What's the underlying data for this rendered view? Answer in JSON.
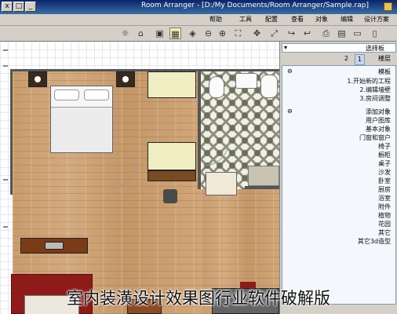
{
  "window": {
    "title": "Room Arranger - [D:/My Documents/Room Arranger/Sample.rap]",
    "buttons": [
      "_",
      "□",
      "x"
    ]
  },
  "menu": [
    "设计方案",
    "编辑",
    "对象",
    "查看",
    "配置",
    "工具",
    "帮助"
  ],
  "toolbar": [
    "new",
    "open",
    "save",
    "print",
    "undo",
    "redo",
    "zoom-in",
    "zoom-out",
    "fit",
    "3d-view",
    "wall",
    "door",
    "window",
    "lamp"
  ],
  "panel": {
    "combo_value": "选择板",
    "tabs": [
      "楼层",
      "1",
      "2"
    ],
    "templates_header": "模板",
    "templates": [
      "1.开始新的工程",
      "2.编辑墙壁",
      "3.房间调整"
    ],
    "objects_header": "添加对象",
    "objects": [
      "用户图库",
      "基本对象",
      "门窗和窗户",
      "椅子",
      "橱柜",
      "桌子",
      "沙发",
      "卧室",
      "厨房",
      "浴室",
      "附件",
      "植物",
      "花园",
      "其它",
      "其它3d造型"
    ]
  },
  "caption": "室内装潢设计效果图行业软件破解版"
}
